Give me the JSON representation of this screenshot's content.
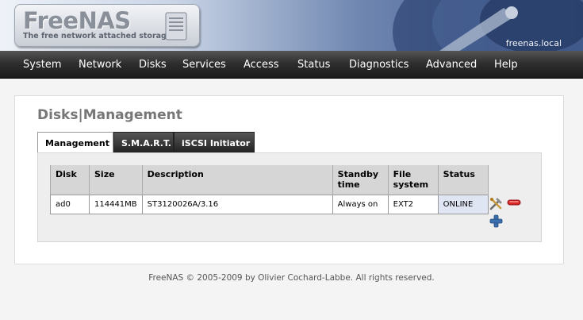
{
  "header": {
    "logo_title": "FreeNAS",
    "logo_tagline": "The free network attached storage",
    "hostname": "freenas.local"
  },
  "nav": {
    "items": [
      "System",
      "Network",
      "Disks",
      "Services",
      "Access",
      "Status",
      "Diagnostics",
      "Advanced",
      "Help"
    ]
  },
  "page": {
    "title": "Disks|Management"
  },
  "tabs": [
    {
      "label": "Management",
      "active": true
    },
    {
      "label": "S.M.A.R.T.",
      "active": false
    },
    {
      "label": "iSCSI Initiator",
      "active": false
    }
  ],
  "disk_table": {
    "columns": [
      "Disk",
      "Size",
      "Description",
      "Standby time",
      "File system",
      "Status"
    ],
    "rows": [
      {
        "disk": "ad0",
        "size": "114441MB",
        "description": "ST3120026A/3.16",
        "standby": "Always on",
        "filesystem": "EXT2",
        "status": "ONLINE"
      }
    ]
  },
  "row_actions": {
    "edit_icon": "edit-tools-icon",
    "delete_icon": "delete-minus-icon",
    "add_icon": "add-plus-icon"
  },
  "footer": {
    "text": "FreeNAS © 2005-2009 by Olivier Cochard-Labbe. All rights reserved."
  },
  "colors": {
    "nav_bg": "#2f2f2f",
    "tab_inactive": "#222222",
    "status_cell": "#dfe5f2",
    "delete_red": "#d62828",
    "add_blue": "#3a6fb0"
  }
}
